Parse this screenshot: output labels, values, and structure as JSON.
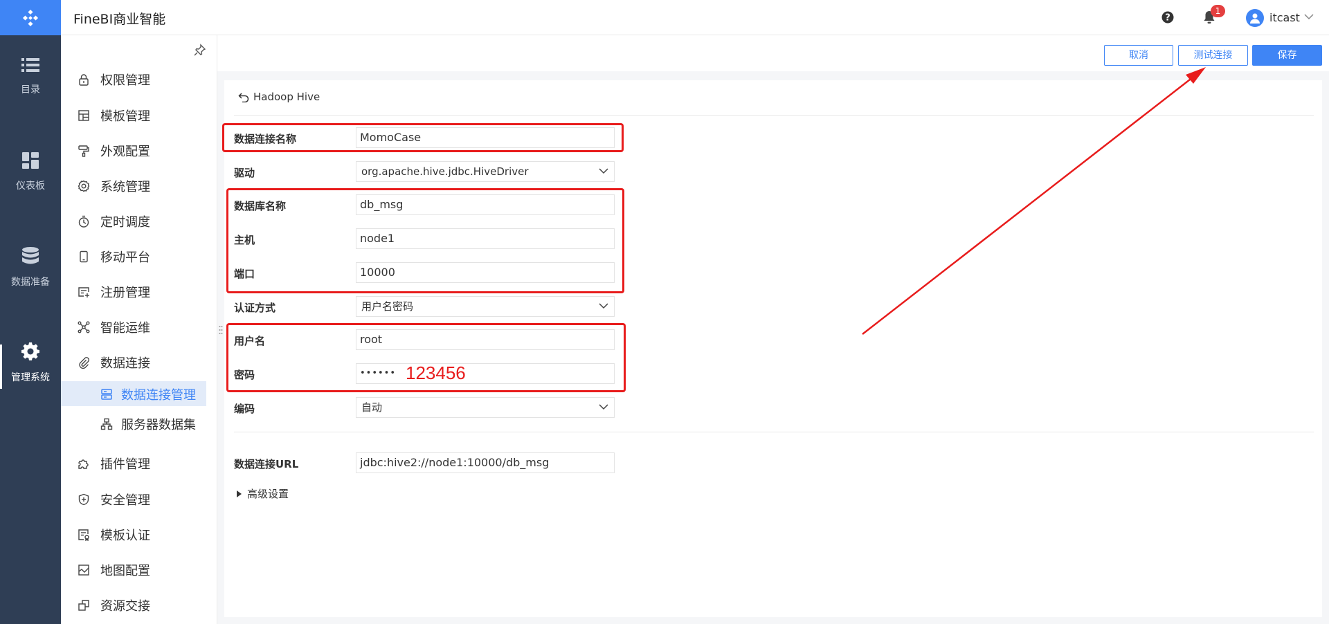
{
  "app": {
    "title": "FineBI商业智能"
  },
  "header": {
    "notification_count": "1",
    "user_name": "itcast"
  },
  "rail": {
    "items": [
      {
        "label": "目录",
        "icon": "list-icon"
      },
      {
        "label": "仪表板",
        "icon": "dashboard-icon"
      },
      {
        "label": "数据准备",
        "icon": "database-icon"
      },
      {
        "label": "管理系统",
        "icon": "gear-icon",
        "active": true
      }
    ]
  },
  "sidebar": {
    "items": [
      {
        "label": "权限管理",
        "icon": "lock-icon"
      },
      {
        "label": "模板管理",
        "icon": "template-icon"
      },
      {
        "label": "外观配置",
        "icon": "paint-roller-icon"
      },
      {
        "label": "系统管理",
        "icon": "settings-icon"
      },
      {
        "label": "定时调度",
        "icon": "timer-icon"
      },
      {
        "label": "移动平台",
        "icon": "mobile-icon"
      },
      {
        "label": "注册管理",
        "icon": "register-icon"
      },
      {
        "label": "智能运维",
        "icon": "network-icon"
      },
      {
        "label": "数据连接",
        "icon": "paperclip-icon"
      },
      {
        "label": "数据连接管理",
        "icon": "server-icon",
        "sub": true,
        "active": true
      },
      {
        "label": "服务器数据集",
        "icon": "dataset-icon",
        "sub": true
      },
      {
        "label": "插件管理",
        "icon": "plugin-icon"
      },
      {
        "label": "安全管理",
        "icon": "shield-icon"
      },
      {
        "label": "模板认证",
        "icon": "certificate-icon"
      },
      {
        "label": "地图配置",
        "icon": "map-icon"
      },
      {
        "label": "资源交接",
        "icon": "handover-icon"
      }
    ]
  },
  "toolbar": {
    "cancel_label": "取消",
    "test_label": "测试连接",
    "save_label": "保存"
  },
  "form": {
    "back_label": "Hadoop Hive",
    "connection_name": {
      "label": "数据连接名称",
      "value": "MomoCase"
    },
    "driver": {
      "label": "驱动",
      "value": "org.apache.hive.jdbc.HiveDriver"
    },
    "database_name": {
      "label": "数据库名称",
      "value": "db_msg"
    },
    "host": {
      "label": "主机",
      "value": "node1"
    },
    "port": {
      "label": "端口",
      "value": "10000"
    },
    "auth": {
      "label": "认证方式",
      "value": "用户名密码"
    },
    "username": {
      "label": "用户名",
      "value": "root"
    },
    "password": {
      "label": "密码",
      "value": "••••••"
    },
    "encoding": {
      "label": "编码",
      "value": "自动"
    },
    "url": {
      "label": "数据连接URL",
      "value": "jdbc:hive2://node1:10000/db_msg"
    },
    "advanced_label": "高级设置"
  },
  "annotation": {
    "password_hint": "123456",
    "color": "#e81c1c"
  },
  "colors": {
    "accent": "#3f85f5",
    "rail": "#2f3e55"
  }
}
